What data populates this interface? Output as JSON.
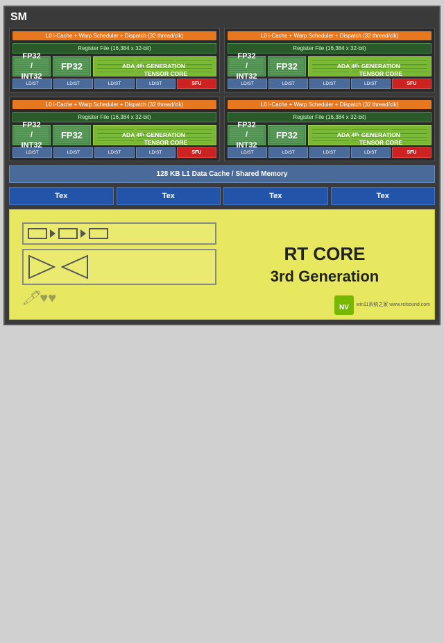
{
  "sm": {
    "title": "SM",
    "warp_bar": "L0 i-Cache + Warp Scheduler + Dispatch (32 thread/clk)",
    "reg_file": "Register File (16,384 x 32-bit)",
    "fp32_int32_label": "FP32\n/\nINT32",
    "fp32_label": "FP32",
    "tensor_label": "ADA 4th\nGENERATION\nTENSOR CORE",
    "ld_st": "LD/ST",
    "sfu": "SFU",
    "l1_cache": "128 KB L1 Data Cache / Shared Memory",
    "tex_labels": [
      "Tex",
      "Tex",
      "Tex",
      "Tex"
    ],
    "rt_core_title": "RT CORE",
    "rt_core_sub": "3rd Generation",
    "watermark": "win11系统之家\nwww.relsound.com"
  },
  "colors": {
    "orange": "#e87820",
    "green_dark": "#4a8a4a",
    "green_mid": "#3a7a3a",
    "green_bright": "#7ab830",
    "blue": "#4a6a9a",
    "blue_dark": "#2255aa",
    "red": "#cc2222",
    "yellow_bg": "#e8e860",
    "bg_dark": "#2a2a2a"
  }
}
